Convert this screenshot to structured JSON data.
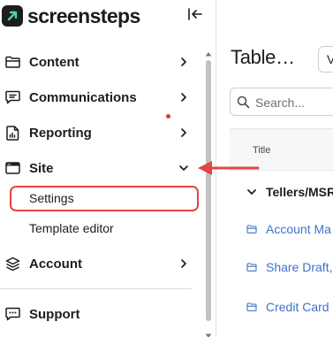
{
  "brand": {
    "name": "screensteps",
    "logo_icon": "arrow-up-right-icon"
  },
  "sidebar": {
    "collapse_icon": "collapse-left-icon",
    "items": [
      {
        "key": "content",
        "label": "Content",
        "icon": "folder-icon",
        "chevron": "chevron-right-icon"
      },
      {
        "key": "communications",
        "label": "Communications",
        "icon": "message-icon",
        "chevron": "chevron-right-icon"
      },
      {
        "key": "reporting",
        "label": "Reporting",
        "icon": "report-icon",
        "chevron": "chevron-right-icon"
      },
      {
        "key": "site",
        "label": "Site",
        "icon": "browser-window-icon",
        "chevron": "chevron-down-icon",
        "expanded": true,
        "children": [
          {
            "label": "Settings",
            "highlighted": true
          },
          {
            "label": "Template editor"
          }
        ]
      },
      {
        "key": "account",
        "label": "Account",
        "icon": "layers-icon",
        "chevron": "chevron-right-icon"
      },
      {
        "key": "support",
        "label": "Support",
        "icon": "chat-bubble-icon"
      }
    ]
  },
  "main": {
    "title": "Table…",
    "view_button": "V",
    "search": {
      "placeholder": "Search..."
    },
    "table": {
      "columns": [
        "Title"
      ],
      "group": {
        "label": "Tellers/MSR",
        "icon": "chevron-down-icon"
      },
      "rows": [
        {
          "label": "Account Ma",
          "icon": "folder-icon"
        },
        {
          "label": "Share Draft,",
          "icon": "folder-icon"
        },
        {
          "label": "Credit Card",
          "icon": "folder-icon"
        }
      ]
    }
  },
  "colors": {
    "annotation": "#e34545",
    "link": "#3d72c8",
    "text": "#1d1d1d",
    "notification_dot": "#d63a3a"
  }
}
